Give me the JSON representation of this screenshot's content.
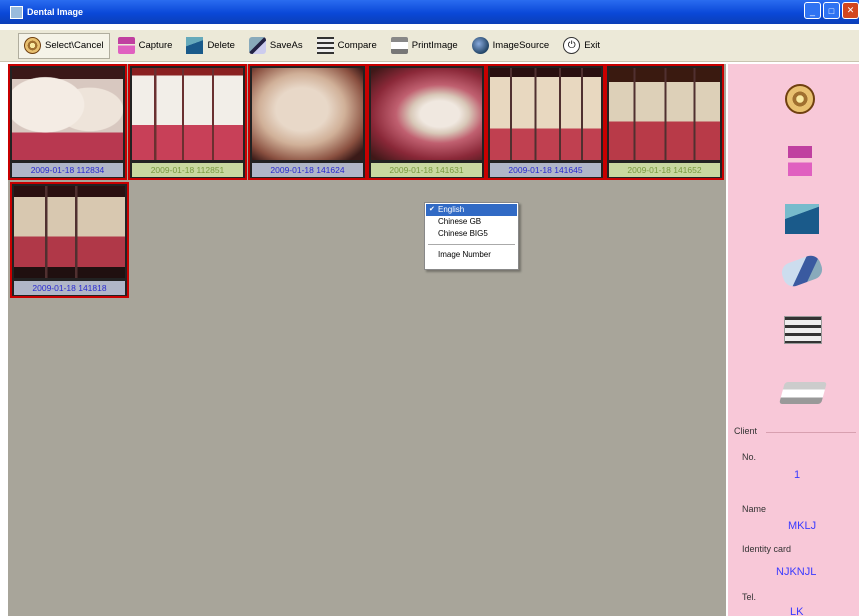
{
  "window": {
    "title": "Dental Image",
    "buttons": [
      "minimize",
      "maximize",
      "close"
    ]
  },
  "toolbar": {
    "items": [
      {
        "label": "Select\\Cancel",
        "icon": "film-reel-icon"
      },
      {
        "label": "Capture",
        "icon": "camera-icon"
      },
      {
        "label": "Delete",
        "icon": "delete-icon"
      },
      {
        "label": "SaveAs",
        "icon": "save-as-icon"
      },
      {
        "label": "Compare",
        "icon": "compare-icon"
      },
      {
        "label": "PrintImage",
        "icon": "print-icon"
      },
      {
        "label": "ImageSource",
        "icon": "image-source-icon"
      },
      {
        "label": "Exit",
        "icon": "exit-icon"
      }
    ]
  },
  "thumbnails": [
    {
      "caption": "2009-01-18 112834",
      "caption_style": "blue"
    },
    {
      "caption": "2009-01-18 112851",
      "caption_style": "green"
    },
    {
      "caption": "2009-01-18 141624",
      "caption_style": "blue"
    },
    {
      "caption": "2009-01-18 141631",
      "caption_style": "green"
    },
    {
      "caption": "2009-01-18 141645",
      "caption_style": "blue"
    },
    {
      "caption": "2009-01-18 141652",
      "caption_style": "green"
    },
    {
      "caption": "2009-01-18 141818",
      "caption_style": "blue"
    }
  ],
  "context_menu": {
    "items": [
      "English",
      "Chinese GB",
      "Chinese BIG5",
      "Image Number"
    ],
    "selected": "English"
  },
  "client": {
    "legend": "Client",
    "no_label": "No.",
    "no_value": "1",
    "name_label": "Name",
    "name_value": "MKLJ",
    "id_label": "Identity card",
    "id_value": "NJKNJL",
    "tel_label": "Tel.",
    "tel_value": "LK"
  },
  "colors": {
    "title_bar": "#0a48d8",
    "side_panel": "#f8c8d8",
    "work_area": "#a8a59a",
    "thumb_border": "#c80000",
    "value_text": "#3a3aff"
  }
}
